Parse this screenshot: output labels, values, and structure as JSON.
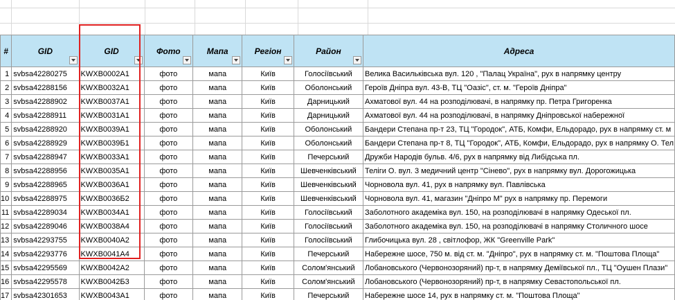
{
  "headers": {
    "num": "#",
    "gid1": "GID",
    "gid2": "GID",
    "photo": "Фото",
    "map": "Мапа",
    "region": "Регіон",
    "district": "Район",
    "address": "Адреса"
  },
  "rows": [
    {
      "n": "1",
      "gid": "svbsa42280275",
      "code": "KWXB0002A1",
      "photo": "фото",
      "map": "мапа",
      "region": "Київ",
      "district": "Голосіївський",
      "address": "Велика Васильківська вул. 120 , \"Палац Україна\", рух в напрямку центру"
    },
    {
      "n": "2",
      "gid": "svbsa42288156",
      "code": "KWXB0032A1",
      "photo": "фото",
      "map": "мапа",
      "region": "Київ",
      "district": "Оболонський",
      "address": "Героїв Дніпра вул. 43-В, ТЦ \"Оазіс\", ст. м. \"Героїв Дніпра\""
    },
    {
      "n": "3",
      "gid": "svbsa42288902",
      "code": "KWXB0037A1",
      "photo": "фото",
      "map": "мапа",
      "region": "Київ",
      "district": "Дарницький",
      "address": "Ахматової вул. 44 на розподілювачі, в напрямку пр. Петра Григоренка"
    },
    {
      "n": "4",
      "gid": "svbsa42288911",
      "code": "KWXB0031A1",
      "photo": "фото",
      "map": "мапа",
      "region": "Київ",
      "district": "Дарницький",
      "address": "Ахматової вул. 44 на розподілювачі, в напрямку Дніпровської набережної"
    },
    {
      "n": "5",
      "gid": "svbsa42288920",
      "code": "KWXB0039A1",
      "photo": "фото",
      "map": "мапа",
      "region": "Київ",
      "district": "Оболонський",
      "address": "Бандери Степана пр-т 23, ТЦ \"Городок\", АТБ, Комфи, Ельдорадо, рух в напрямку ст. м"
    },
    {
      "n": "6",
      "gid": "svbsa42288929",
      "code": "KWXB0039Б1",
      "photo": "фото",
      "map": "мапа",
      "region": "Київ",
      "district": "Оболонський",
      "address": "Бандери Степана пр-т 8, ТЦ \"Городок\", АТБ, Комфи, Ельдорадо, рух в напрямку О. Тел"
    },
    {
      "n": "7",
      "gid": "svbsa42288947",
      "code": "KWXB0033A1",
      "photo": "фото",
      "map": "мапа",
      "region": "Київ",
      "district": "Печерський",
      "address": "Дружби Народів бульв.  4/6, рух в напрямку від Либідська пл."
    },
    {
      "n": "8",
      "gid": "svbsa42288956",
      "code": "KWXB0035A1",
      "photo": "фото",
      "map": "мапа",
      "region": "Київ",
      "district": "Шевченківський",
      "address": "Теліги О. вул. 3 медичний центр \"Сінево\", рух в напрямку вул. Дорогожицька"
    },
    {
      "n": "9",
      "gid": "svbsa42288965",
      "code": "KWXB0036A1",
      "photo": "фото",
      "map": "мапа",
      "region": "Київ",
      "district": "Шевченківський",
      "address": "Чорновола вул. 41, рух в напрямку вул. Павлівська"
    },
    {
      "n": "10",
      "gid": "svbsa42288975",
      "code": "KWXB0036Б2",
      "photo": "фото",
      "map": "мапа",
      "region": "Київ",
      "district": "Шевченківський",
      "address": "Чорновола вул. 41, магазин \"Дніпро М\" рух в напрямку пр. Перемоги"
    },
    {
      "n": "11",
      "gid": "svbsa42289034",
      "code": "KWXB0034A1",
      "photo": "фото",
      "map": "мапа",
      "region": "Київ",
      "district": "Голосіївський",
      "address": "Заболотного академіка вул. 150, на розподілювачі в напрямку Одеської пл."
    },
    {
      "n": "12",
      "gid": "svbsa42289046",
      "code": "KWXB0038A4",
      "photo": "фото",
      "map": "мапа",
      "region": "Київ",
      "district": "Голосіївський",
      "address": "Заболотного академіка вул. 150, на розподілювачі в напрямку Столичного шосе"
    },
    {
      "n": "13",
      "gid": "svbsa42293755",
      "code": "KWXB0040A2",
      "photo": "фото",
      "map": "мапа",
      "region": "Київ",
      "district": "Голосіївський",
      "address": "Глибочицька вул. 28 , світлофор, ЖК \"Greenville Park\""
    },
    {
      "n": "14",
      "gid": "svbsa42293776",
      "code": "KWXB0041A4",
      "photo": "фото",
      "map": "мапа",
      "region": "Київ",
      "district": "Печерський",
      "address": "Набережне шосе, 750 м. від ст. м. \"Дніпро\", рух в напрямку ст. м. \"Поштова Площа\""
    },
    {
      "n": "15",
      "gid": "svbsa42295569",
      "code": "KWXB0042A2",
      "photo": "фото",
      "map": "мапа",
      "region": "Київ",
      "district": "Солом'янський",
      "address": "Лобановського (Червонозоряний) пр-т, в напрямку Деміївської пл., ТЦ \"Оушен Плази\""
    },
    {
      "n": "16",
      "gid": "svbsa42295578",
      "code": "KWXB0042Б3",
      "photo": "фото",
      "map": "мапа",
      "region": "Київ",
      "district": "Солом'янський",
      "address": "Лобановського (Червонозоряний) пр-т, в напрямку Севастопольської пл."
    },
    {
      "n": "17",
      "gid": "svbsa42301653",
      "code": "KWXB0043A1",
      "photo": "фото",
      "map": "мапа",
      "region": "Київ",
      "district": "Печерський",
      "address": "Набережне шосе 14, рух в напрямку ст. м. \"Поштова Площа\""
    }
  ]
}
